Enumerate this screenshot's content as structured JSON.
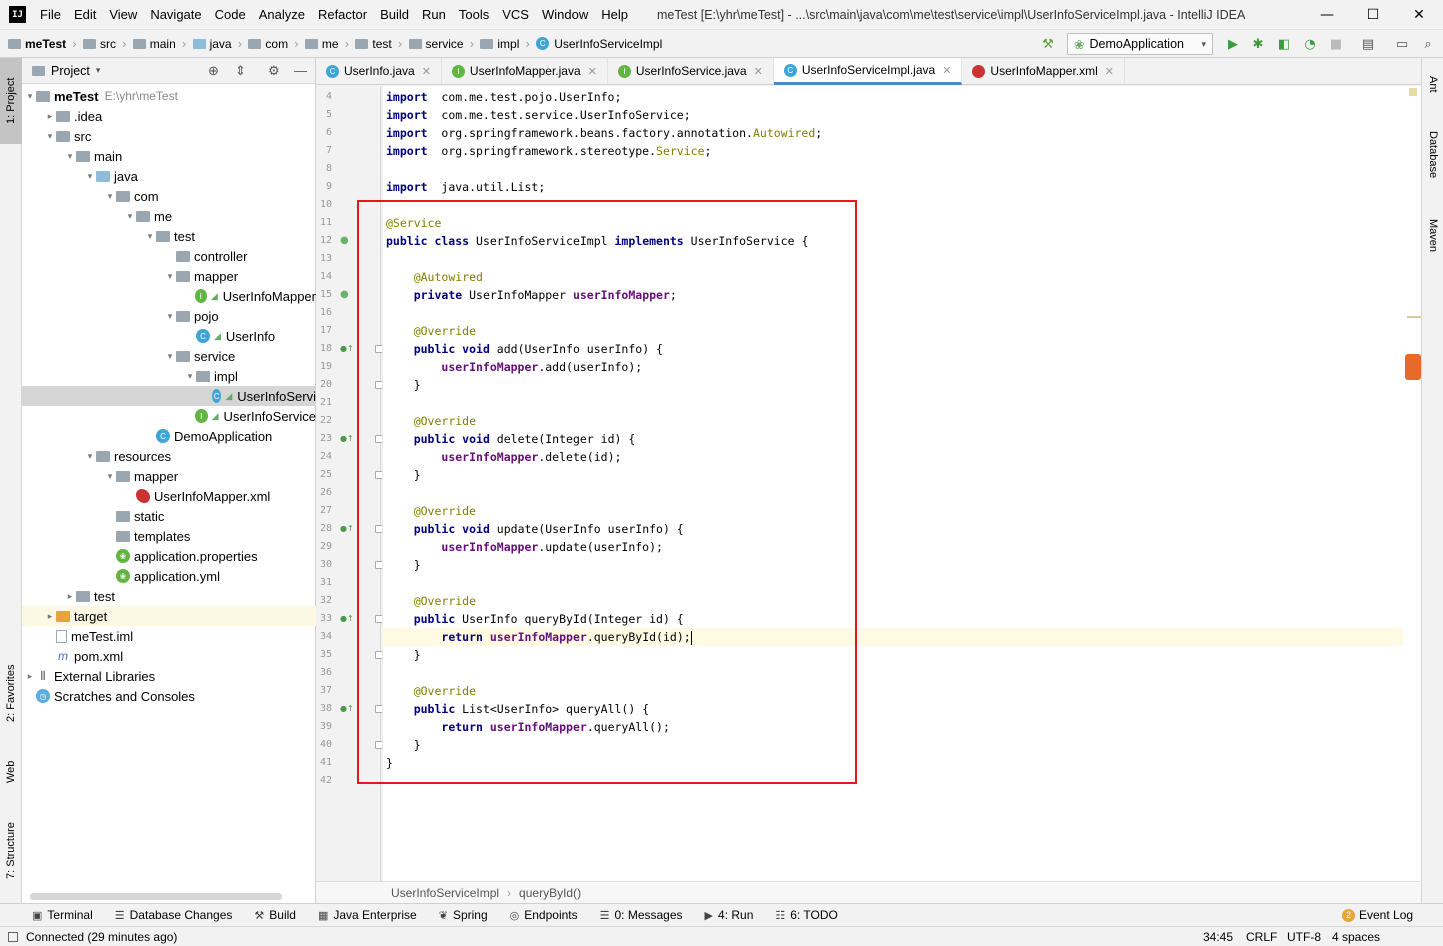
{
  "window": {
    "title": "meTest [E:\\yhr\\meTest] - ...\\src\\main\\java\\com\\me\\test\\service\\impl\\UserInfoServiceImpl.java - IntelliJ IDEA",
    "app_icon": "IJ",
    "controls": {
      "minimize": "—",
      "maximize": "☐",
      "close": "✕"
    }
  },
  "menu": [
    "File",
    "Edit",
    "View",
    "Navigate",
    "Code",
    "Analyze",
    "Refactor",
    "Build",
    "Run",
    "Tools",
    "VCS",
    "Window",
    "Help"
  ],
  "breadcrumbs": [
    "meTest",
    "src",
    "main",
    "java",
    "com",
    "me",
    "test",
    "service",
    "impl",
    "UserInfoServiceImpl"
  ],
  "run_config": {
    "label": "DemoApplication"
  },
  "left_tool_tabs": {
    "project": "1: Project",
    "favorites": "2: Favorites",
    "web": "Web",
    "structure": "7: Structure"
  },
  "right_tool_tabs": {
    "ant": "Ant",
    "database": "Database",
    "maven": "Maven"
  },
  "project_panel": {
    "title": "Project",
    "tree": [
      {
        "label": "meTest",
        "extra": "E:\\yhr\\meTest",
        "icon": "folder",
        "arrow": "▾",
        "depth": 0,
        "bold": true
      },
      {
        "label": ".idea",
        "icon": "folder",
        "arrow": "▸",
        "depth": 1
      },
      {
        "label": "src",
        "icon": "folder",
        "arrow": "▾",
        "depth": 1
      },
      {
        "label": "main",
        "icon": "folder",
        "arrow": "▾",
        "depth": 2
      },
      {
        "label": "java",
        "icon": "folder-blue",
        "arrow": "▾",
        "depth": 3
      },
      {
        "label": "com",
        "icon": "folder",
        "arrow": "▾",
        "depth": 4
      },
      {
        "label": "me",
        "icon": "folder",
        "arrow": "▾",
        "depth": 5
      },
      {
        "label": "test",
        "icon": "folder",
        "arrow": "▾",
        "depth": 6
      },
      {
        "label": "controller",
        "icon": "folder",
        "arrow": "",
        "depth": 7
      },
      {
        "label": "mapper",
        "icon": "folder",
        "arrow": "▾",
        "depth": 7
      },
      {
        "label": "UserInfoMapper",
        "icon": "interface",
        "arrow": "",
        "depth": 8
      },
      {
        "label": "pojo",
        "icon": "folder",
        "arrow": "▾",
        "depth": 7
      },
      {
        "label": "UserInfo",
        "icon": "class",
        "arrow": "",
        "depth": 8
      },
      {
        "label": "service",
        "icon": "folder",
        "arrow": "▾",
        "depth": 7
      },
      {
        "label": "impl",
        "icon": "folder",
        "arrow": "▾",
        "depth": 8
      },
      {
        "label": "UserInfoServi",
        "icon": "class",
        "arrow": "",
        "depth": 9,
        "selected": true
      },
      {
        "label": "UserInfoService",
        "icon": "interface",
        "arrow": "",
        "depth": 8
      },
      {
        "label": "DemoApplication",
        "icon": "class-spring",
        "arrow": "",
        "depth": 6
      },
      {
        "label": "resources",
        "icon": "folder",
        "arrow": "▾",
        "depth": 3
      },
      {
        "label": "mapper",
        "icon": "folder",
        "arrow": "▾",
        "depth": 4
      },
      {
        "label": "UserInfoMapper.xml",
        "icon": "xml",
        "arrow": "",
        "depth": 5
      },
      {
        "label": "static",
        "icon": "folder",
        "arrow": "",
        "depth": 4
      },
      {
        "label": "templates",
        "icon": "folder",
        "arrow": "",
        "depth": 4
      },
      {
        "label": "application.properties",
        "icon": "spring-file",
        "arrow": "",
        "depth": 4
      },
      {
        "label": "application.yml",
        "icon": "spring-file",
        "arrow": "",
        "depth": 4
      },
      {
        "label": "test",
        "icon": "folder",
        "arrow": "▸",
        "depth": 2
      },
      {
        "label": "target",
        "icon": "folder-orange",
        "arrow": "▸",
        "depth": 1,
        "highlight": true
      },
      {
        "label": "meTest.iml",
        "icon": "file",
        "arrow": "",
        "depth": 1
      },
      {
        "label": "pom.xml",
        "icon": "maven",
        "arrow": "",
        "depth": 1
      },
      {
        "label": "External Libraries",
        "icon": "library",
        "arrow": "▸",
        "depth": 0
      },
      {
        "label": "Scratches and Consoles",
        "icon": "scratch",
        "arrow": "",
        "depth": 0
      }
    ]
  },
  "editor_tabs": [
    {
      "label": "UserInfo.java",
      "icon": "class"
    },
    {
      "label": "UserInfoMapper.java",
      "icon": "interface"
    },
    {
      "label": "UserInfoService.java",
      "icon": "interface"
    },
    {
      "label": "UserInfoServiceImpl.java",
      "icon": "class",
      "active": true
    },
    {
      "label": "UserInfoMapper.xml",
      "icon": "xml"
    }
  ],
  "code": [
    {
      "n": "4",
      "t": [
        [
          "kw",
          "import"
        ],
        [
          "",
          "  com.me.test.pojo.UserInfo;"
        ]
      ]
    },
    {
      "n": "5",
      "t": [
        [
          "kw",
          "import"
        ],
        [
          "",
          "  com.me.test.service.UserInfoService;"
        ]
      ]
    },
    {
      "n": "6",
      "t": [
        [
          "kw",
          "import"
        ],
        [
          "",
          "  org.springframework.beans.factory.annotation."
        ],
        [
          "an",
          "Autowired"
        ],
        [
          "",
          ";"
        ]
      ]
    },
    {
      "n": "7",
      "t": [
        [
          "kw",
          "import"
        ],
        [
          "",
          "  org.springframework.stereotype."
        ],
        [
          "an",
          "Service"
        ],
        [
          "",
          ";"
        ]
      ]
    },
    {
      "n": "8",
      "t": []
    },
    {
      "n": "9",
      "t": [
        [
          "kw",
          "import"
        ],
        [
          "",
          "  java.util.List;"
        ]
      ]
    },
    {
      "n": "10",
      "t": []
    },
    {
      "n": "11",
      "t": [
        [
          "an",
          "@Service"
        ]
      ]
    },
    {
      "n": "12",
      "t": [
        [
          "kw",
          "public class"
        ],
        [
          "",
          " UserInfoServiceImpl "
        ],
        [
          "kw",
          "implements"
        ],
        [
          "",
          " UserInfoService {"
        ]
      ],
      "mark": "bean"
    },
    {
      "n": "13",
      "t": []
    },
    {
      "n": "14",
      "t": [
        [
          "",
          "    "
        ],
        [
          "an",
          "@Autowired"
        ]
      ]
    },
    {
      "n": "15",
      "t": [
        [
          "",
          "    "
        ],
        [
          "kw",
          "private"
        ],
        [
          "",
          " UserInfoMapper "
        ],
        [
          "fld",
          "userInfoMapper"
        ],
        [
          "",
          ";"
        ]
      ],
      "mark": "bean"
    },
    {
      "n": "16",
      "t": []
    },
    {
      "n": "17",
      "t": [
        [
          "",
          "    "
        ],
        [
          "an",
          "@Override"
        ]
      ]
    },
    {
      "n": "18",
      "t": [
        [
          "",
          "    "
        ],
        [
          "kw",
          "public void"
        ],
        [
          "",
          " add(UserInfo userInfo) {"
        ]
      ],
      "mark": "impl",
      "fold": true
    },
    {
      "n": "19",
      "t": [
        [
          "",
          "        "
        ],
        [
          "fld",
          "userInfoMapper"
        ],
        [
          "",
          ".add(userInfo);"
        ]
      ]
    },
    {
      "n": "20",
      "t": [
        [
          "",
          "    }"
        ]
      ],
      "fold": true
    },
    {
      "n": "21",
      "t": []
    },
    {
      "n": "22",
      "t": [
        [
          "",
          "    "
        ],
        [
          "an",
          "@Override"
        ]
      ]
    },
    {
      "n": "23",
      "t": [
        [
          "",
          "    "
        ],
        [
          "kw",
          "public void"
        ],
        [
          "",
          " delete(Integer id) {"
        ]
      ],
      "mark": "impl",
      "fold": true
    },
    {
      "n": "24",
      "t": [
        [
          "",
          "        "
        ],
        [
          "fld",
          "userInfoMapper"
        ],
        [
          "",
          ".delete(id);"
        ]
      ]
    },
    {
      "n": "25",
      "t": [
        [
          "",
          "    }"
        ]
      ],
      "fold": true
    },
    {
      "n": "26",
      "t": []
    },
    {
      "n": "27",
      "t": [
        [
          "",
          "    "
        ],
        [
          "an",
          "@Override"
        ]
      ]
    },
    {
      "n": "28",
      "t": [
        [
          "",
          "    "
        ],
        [
          "kw",
          "public void"
        ],
        [
          "",
          " update(UserInfo userInfo) {"
        ]
      ],
      "mark": "impl",
      "fold": true
    },
    {
      "n": "29",
      "t": [
        [
          "",
          "        "
        ],
        [
          "fld",
          "userInfoMapper"
        ],
        [
          "",
          ".update(userInfo);"
        ]
      ]
    },
    {
      "n": "30",
      "t": [
        [
          "",
          "    }"
        ]
      ],
      "fold": true
    },
    {
      "n": "31",
      "t": []
    },
    {
      "n": "32",
      "t": [
        [
          "",
          "    "
        ],
        [
          "an",
          "@Override"
        ]
      ]
    },
    {
      "n": "33",
      "t": [
        [
          "",
          "    "
        ],
        [
          "kw",
          "public"
        ],
        [
          "",
          " UserInfo queryById(Integer id) {"
        ]
      ],
      "mark": "impl",
      "fold": true
    },
    {
      "n": "34",
      "t": [
        [
          "",
          "        "
        ],
        [
          "kw",
          "return"
        ],
        [
          "",
          " "
        ],
        [
          "fld",
          "userInfoMapper"
        ],
        [
          "",
          ".queryById(id);"
        ]
      ],
      "caret": true,
      "bulb": true
    },
    {
      "n": "35",
      "t": [
        [
          "",
          "    }"
        ]
      ],
      "fold": true
    },
    {
      "n": "36",
      "t": []
    },
    {
      "n": "37",
      "t": [
        [
          "",
          "    "
        ],
        [
          "an",
          "@Override"
        ]
      ]
    },
    {
      "n": "38",
      "t": [
        [
          "",
          "    "
        ],
        [
          "kw",
          "public"
        ],
        [
          "",
          " List<UserInfo> queryAll() {"
        ]
      ],
      "mark": "impl",
      "fold": true
    },
    {
      "n": "39",
      "t": [
        [
          "",
          "        "
        ],
        [
          "kw",
          "return"
        ],
        [
          "",
          " "
        ],
        [
          "fld",
          "userInfoMapper"
        ],
        [
          "",
          ".queryAll();"
        ]
      ]
    },
    {
      "n": "40",
      "t": [
        [
          "",
          "    }"
        ]
      ],
      "fold": true
    },
    {
      "n": "41",
      "t": [
        [
          "",
          "}"
        ]
      ]
    },
    {
      "n": "42",
      "t": []
    }
  ],
  "editor_breadcrumb": [
    "UserInfoServiceImpl",
    "queryById()"
  ],
  "tool_windows": [
    {
      "label": "Terminal",
      "icon": "▣"
    },
    {
      "label": "Database Changes",
      "icon": "☰"
    },
    {
      "label": "Build",
      "icon": "⚒"
    },
    {
      "label": "Java Enterprise",
      "icon": "▦"
    },
    {
      "label": "Spring",
      "icon": "❦"
    },
    {
      "label": "Endpoints",
      "icon": "◎"
    },
    {
      "label": "0: Messages",
      "icon": "☰"
    },
    {
      "label": "4: Run",
      "icon": "▶"
    },
    {
      "label": "6: TODO",
      "icon": "☷"
    }
  ],
  "event_log": {
    "label": "Event Log",
    "count": "2"
  },
  "status": {
    "message": "Connected (29 minutes ago)",
    "position": "34:45",
    "line_sep": "CRLF",
    "encoding": "UTF-8",
    "indent": "4 spaces"
  },
  "colors": {
    "accent": "#4a88c7",
    "highlight_box": "#e8161f",
    "keyword": "#000080",
    "annotation": "#808000",
    "field": "#660e7a"
  }
}
